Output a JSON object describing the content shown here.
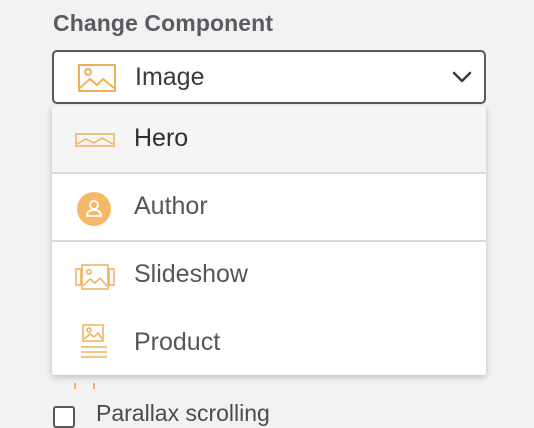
{
  "section_title": "Change Component",
  "select": {
    "value": "Image",
    "icon": "image-icon",
    "expanded": true
  },
  "options": [
    {
      "label": "Hero",
      "icon": "hero-banner-icon",
      "highlighted": true
    },
    {
      "label": "Author",
      "icon": "author-avatar-icon"
    },
    {
      "label": "Slideshow",
      "icon": "slideshow-icon"
    },
    {
      "label": "Product",
      "icon": "product-icon"
    }
  ],
  "checkbox": {
    "label": "Parallax scrolling",
    "checked": false
  },
  "colors": {
    "accent": "#f0b05a",
    "accent_fill": "#f4b968",
    "border": "#58585e",
    "text": "#3a3a3f",
    "page_background": "#f2f2f3"
  }
}
